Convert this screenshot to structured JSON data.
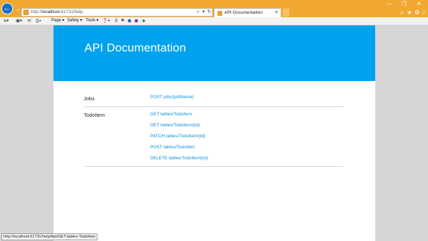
{
  "browser": {
    "address": {
      "url_prefix": "http://",
      "url_host": "localhost",
      "url_rest": ":61731/help",
      "search_glyph": "⌕",
      "dropdown_glyph": "▾",
      "refresh_glyph": "↻"
    },
    "tab": {
      "title": "API Documentation",
      "close_glyph": "✕"
    },
    "window_controls": {
      "minimize": "—",
      "restore": "❐",
      "close": "✕"
    },
    "right_icons": {
      "home": "⌂",
      "favorites": "★",
      "settings": "⚙",
      "feedback": "☺"
    },
    "nav": {
      "back": "←",
      "forward": "→"
    },
    "accent_color": "#f0a830"
  },
  "command_bar": {
    "items": [
      {
        "label": "Page"
      },
      {
        "label": "Safety"
      },
      {
        "label": "Tools"
      }
    ]
  },
  "page": {
    "title": "API Documentation",
    "hero_color": "#00a2ed",
    "link_color": "#0a8fd8",
    "groups": [
      {
        "name": "Jobs",
        "apis": [
          "POST jobs/{jobName}"
        ]
      },
      {
        "name": "TodoItem",
        "apis": [
          "GET tables/TodoItem",
          "GET tables/TodoItem/{id}",
          "PATCH tables/TodoItem/{id}",
          "POST tables/TodoItem",
          "DELETE tables/TodoItem/{id}"
        ]
      }
    ]
  },
  "status_bar": {
    "text": "http://localhost:61731/help/Api/GET-tables-TodoItem"
  }
}
